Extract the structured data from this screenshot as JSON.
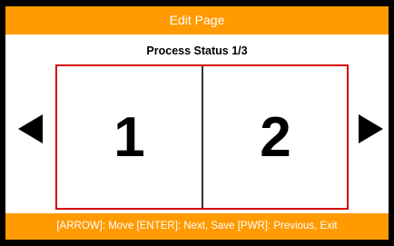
{
  "header": {
    "title": "Edit Page"
  },
  "subtitle": "Process Status 1/3",
  "pages": [
    {
      "label": "1"
    },
    {
      "label": "2"
    }
  ],
  "navigation": {
    "prev_icon": "left-triangle-icon",
    "next_icon": "right-triangle-icon"
  },
  "footer": {
    "help_text": "[ARROW]: Move [ENTER]:  Next, Save [PWR]: Previous, Exit"
  },
  "colors": {
    "accent": "#ff9a00",
    "frame_border": "#d40000",
    "background": "#ffffff",
    "bezel": "#000000"
  }
}
